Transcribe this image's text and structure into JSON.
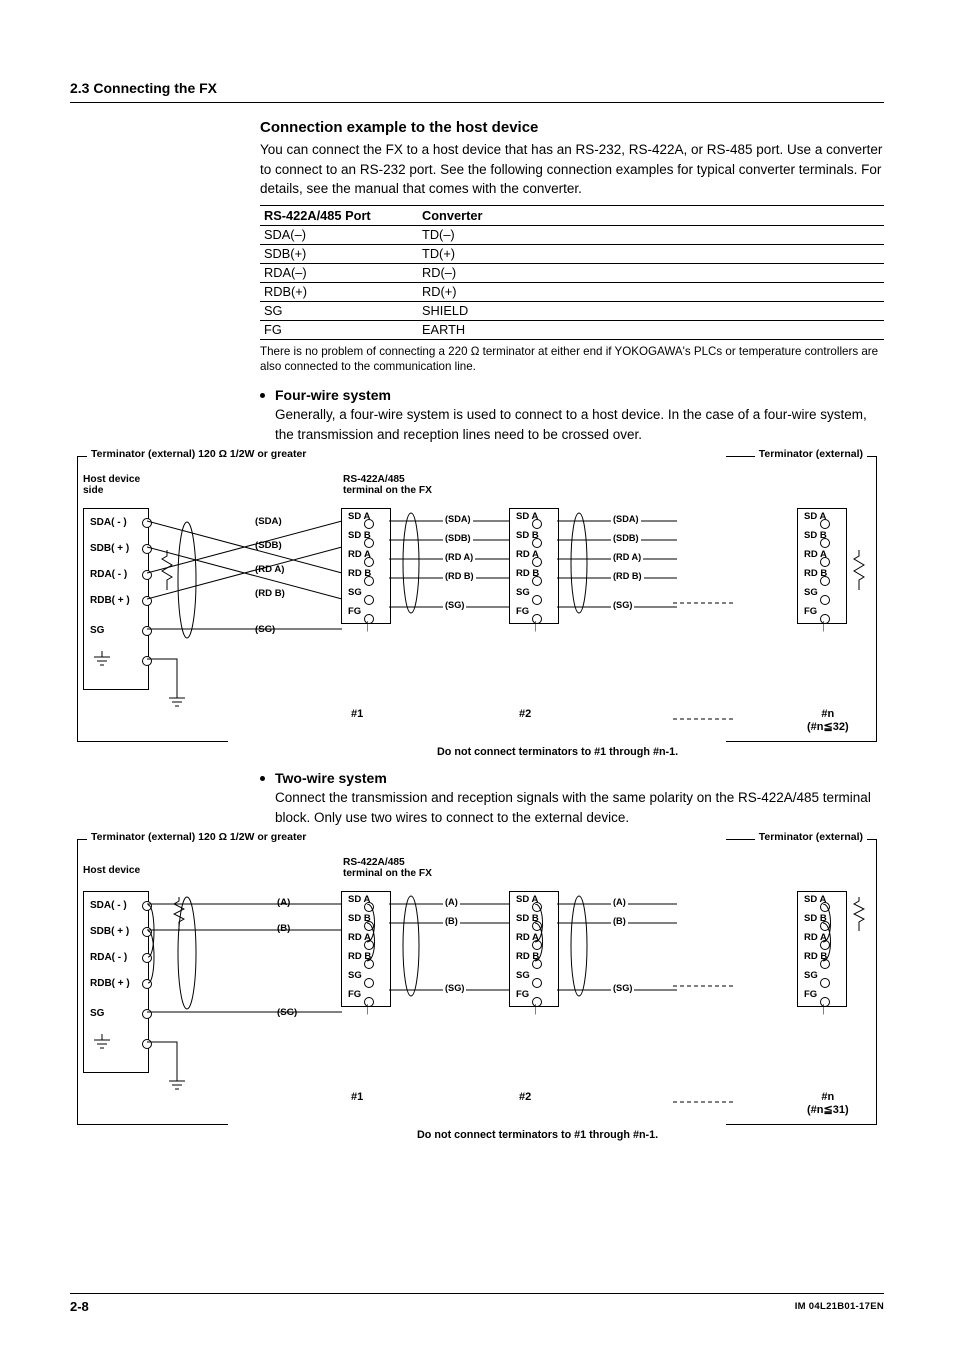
{
  "section_header": "2.3  Connecting the FX",
  "conn_example": {
    "title": "Connection example to the host device",
    "body": "You can connect the FX to a host device that has an RS-232, RS-422A, or RS-485 port. Use a converter to connect to an RS-232 port. See the following connection examples for typical converter terminals. For details, see the manual that comes with the converter.",
    "table_headers": [
      "RS-422A/485 Port",
      "Converter"
    ],
    "table_rows": [
      [
        "SDA(–)",
        "TD(–)"
      ],
      [
        "SDB(+)",
        "TD(+)"
      ],
      [
        "RDA(–)",
        "RD(–)"
      ],
      [
        "RDB(+)",
        "RD(+)"
      ],
      [
        "SG",
        "SHIELD"
      ],
      [
        "FG",
        "EARTH"
      ]
    ],
    "note": "There is no problem of connecting a 220 Ω terminator at either end if YOKOGAWA's PLCs or temperature controllers are also connected to the communication line."
  },
  "fourwire": {
    "title": "Four-wire system",
    "body": "Generally, a four-wire system is used to connect to a host device. In the case of a four-wire system, the transmission and reception lines need to be crossed over."
  },
  "twowire": {
    "title": "Two-wire system",
    "body": "Connect the transmission and reception signals with the same polarity on the RS-422A/485 terminal block. Only use two wires to connect to the external device."
  },
  "diagram_common": {
    "term_ext_left": "Terminator (external) 120 Ω 1/2W or greater",
    "term_ext_right": "Terminator (external)",
    "host_side_4w": "Host device\nside",
    "host_side_2w": "Host device",
    "fx_terminal": "RS-422A/485\nterminal on the FX",
    "host_signals": [
      "SDA( - )",
      "SDB( + )",
      "RDA( - )",
      "RDB( + )",
      "SG",
      ""
    ],
    "cable_labels_4": [
      "(SDA)",
      "(SDB)",
      "(RD A)",
      "(RD B)",
      "(SG)"
    ],
    "cable_labels_2": [
      "(A)",
      "(B)",
      "(SG)"
    ],
    "module_rows": [
      "SD  A",
      "SD  B",
      "RD  A",
      "RD  B",
      "SG",
      "FG"
    ],
    "num1": "#1",
    "num2": "#2",
    "numn4": "#n\n(#n≦32)",
    "numn2": "#n\n(#n≦31)",
    "caption": "Do not connect terminators to #1 through #n-1."
  },
  "footer": {
    "left": "2-8",
    "right": "IM 04L21B01-17EN"
  }
}
